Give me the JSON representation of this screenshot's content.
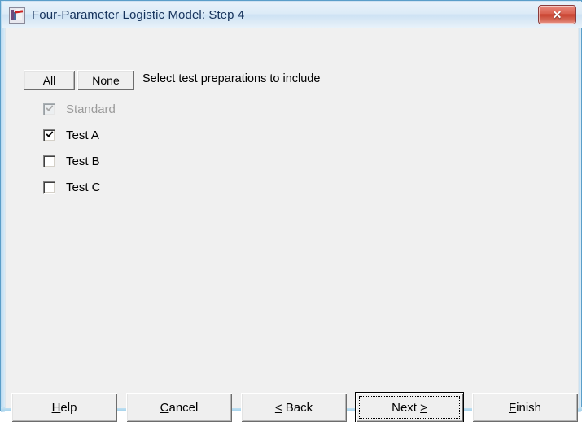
{
  "window": {
    "title": "Four-Parameter Logistic Model: Step 4",
    "icon": "app-window-icon",
    "close_label": "✕",
    "accent_title_text_color": "#16335c",
    "titlebar_color": "#dceaf6",
    "client_background": "#f0f0f0",
    "close_button_color": "#c8412f",
    "frame_color": "#a8d4ec"
  },
  "toolbar": {
    "all_label": "All",
    "none_label": "None",
    "hint": "Select test preparations to include"
  },
  "preparations": {
    "items": [
      {
        "label": "Standard",
        "checked": true,
        "enabled": false
      },
      {
        "label": "Test A",
        "checked": true,
        "enabled": true
      },
      {
        "label": "Test B",
        "checked": false,
        "enabled": true
      },
      {
        "label": "Test C",
        "checked": false,
        "enabled": true
      }
    ]
  },
  "buttons": {
    "help": {
      "accel": "H",
      "rest": "elp",
      "prefix": ""
    },
    "cancel": {
      "accel": "C",
      "rest": "ancel",
      "prefix": ""
    },
    "back": {
      "accel": "<",
      "rest": " Back",
      "prefix": ""
    },
    "next": {
      "accel": ">",
      "rest": "Next ",
      "prefix": "Next "
    },
    "finish": {
      "accel": "F",
      "rest": "inish",
      "prefix": ""
    }
  },
  "labels": {
    "help_full": "Help",
    "cancel_full": "Cancel",
    "back_full": "< Back",
    "next_full": "Next >",
    "finish_full": "Finish"
  }
}
